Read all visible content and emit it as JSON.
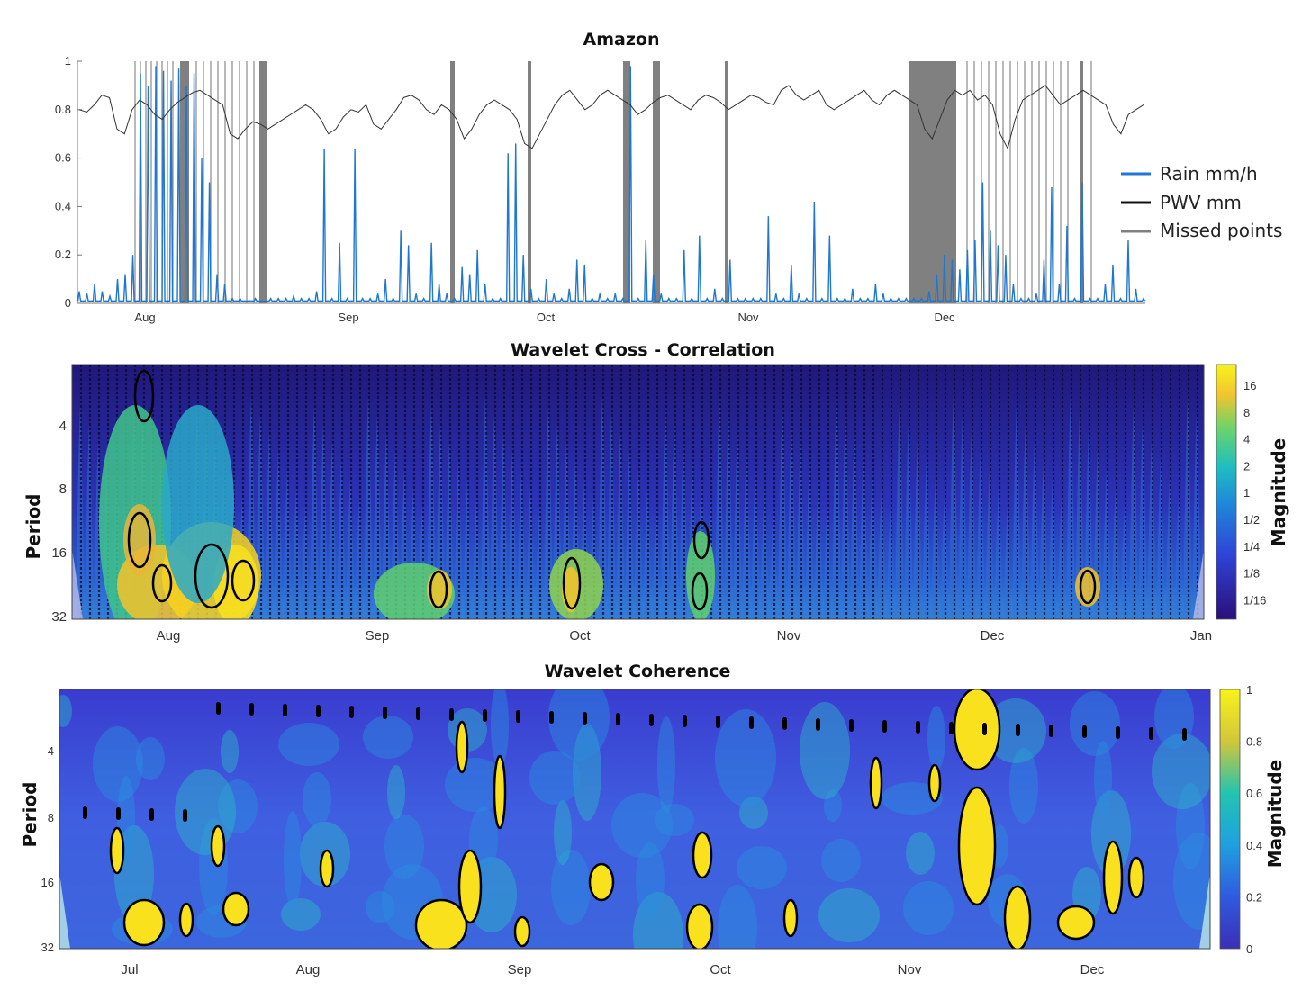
{
  "chart_data": [
    {
      "type": "line",
      "title": "Amazon",
      "xlabel": "",
      "ylabel": "",
      "ylim": [
        0,
        1
      ],
      "yticks": [
        "0",
        "0.2",
        "0.4",
        "0.6",
        "0.8",
        "1"
      ],
      "x_tick_labels": [
        "Aug",
        "Sep",
        "Oct",
        "Nov",
        "Dec"
      ],
      "legend": {
        "placement": "right",
        "entries": [
          {
            "label": "Rain mm/h",
            "color": "#1f77d0"
          },
          {
            "label": "PWV mm",
            "color": "#111111"
          },
          {
            "label": "Missed points",
            "color": "#808080"
          }
        ]
      },
      "series": [
        {
          "name": "PWV mm",
          "color": "#333333",
          "values": [
            0.8,
            0.79,
            0.82,
            0.86,
            0.85,
            0.72,
            0.7,
            0.8,
            0.84,
            0.82,
            0.78,
            0.76,
            0.8,
            0.83,
            0.85,
            0.87,
            0.88,
            0.86,
            0.84,
            0.82,
            0.7,
            0.68,
            0.72,
            0.75,
            0.74,
            0.72,
            0.74,
            0.76,
            0.78,
            0.8,
            0.82,
            0.8,
            0.76,
            0.7,
            0.72,
            0.77,
            0.8,
            0.79,
            0.82,
            0.74,
            0.72,
            0.76,
            0.8,
            0.85,
            0.86,
            0.84,
            0.8,
            0.78,
            0.82,
            0.8,
            0.76,
            0.68,
            0.72,
            0.78,
            0.82,
            0.84,
            0.82,
            0.8,
            0.76,
            0.66,
            0.64,
            0.7,
            0.76,
            0.82,
            0.86,
            0.88,
            0.84,
            0.8,
            0.82,
            0.86,
            0.88,
            0.86,
            0.84,
            0.82,
            0.78,
            0.8,
            0.83,
            0.85,
            0.86,
            0.84,
            0.82,
            0.8,
            0.84,
            0.86,
            0.85,
            0.83,
            0.8,
            0.82,
            0.84,
            0.86,
            0.85,
            0.83,
            0.82,
            0.88,
            0.9,
            0.86,
            0.84,
            0.86,
            0.88,
            0.82,
            0.8,
            0.82,
            0.84,
            0.86,
            0.88,
            0.84,
            0.82,
            0.86,
            0.88,
            0.86,
            0.84,
            0.82,
            0.72,
            0.68,
            0.76,
            0.84,
            0.88,
            0.86,
            0.88,
            0.84,
            0.86,
            0.82,
            0.7,
            0.64,
            0.76,
            0.84,
            0.86,
            0.88,
            0.9,
            0.86,
            0.82,
            0.84,
            0.86,
            0.88,
            0.86,
            0.84,
            0.82,
            0.74,
            0.7,
            0.78,
            0.8,
            0.82
          ]
        },
        {
          "name": "Rain mm/h",
          "color": "#1f77d0",
          "values": [
            0.05,
            0.04,
            0.08,
            0.05,
            0.03,
            0.1,
            0.12,
            0.2,
            0.95,
            0.9,
            0.98,
            0.96,
            0.92,
            0.97,
            0.9,
            0.95,
            0.6,
            0.5,
            0.12,
            0.08,
            0.02,
            0.02,
            0.01,
            0.02,
            0.01,
            0.02,
            0.02,
            0.02,
            0.03,
            0.02,
            0.02,
            0.05,
            0.64,
            0.02,
            0.25,
            0.02,
            0.64,
            0.02,
            0.02,
            0.04,
            0.1,
            0.02,
            0.3,
            0.24,
            0.04,
            0.02,
            0.25,
            0.08,
            0.04,
            0.02,
            0.15,
            0.12,
            0.22,
            0.08,
            0.02,
            0.02,
            0.62,
            0.66,
            0.2,
            0.06,
            0.02,
            0.1,
            0.04,
            0.02,
            0.06,
            0.18,
            0.16,
            0.02,
            0.04,
            0.02,
            0.04,
            0.02,
            0.98,
            0.02,
            0.26,
            0.12,
            0.04,
            0.02,
            0.02,
            0.22,
            0.02,
            0.28,
            0.02,
            0.06,
            0.02,
            0.18,
            0.02,
            0.02,
            0.02,
            0.02,
            0.36,
            0.04,
            0.02,
            0.16,
            0.04,
            0.02,
            0.42,
            0.02,
            0.28,
            0.02,
            0.02,
            0.06,
            0.02,
            0.02,
            0.08,
            0.04,
            0.02,
            0.02,
            0.02,
            0.02,
            0.02,
            0.05,
            0.12,
            0.2,
            0.18,
            0.14,
            0.22,
            0.26,
            0.5,
            0.3,
            0.24,
            0.2,
            0.08,
            0.02,
            0.02,
            0.04,
            0.18,
            0.48,
            0.08,
            0.32,
            0.02,
            0.5,
            0.02,
            0.02,
            0.08,
            0.16,
            0.02,
            0.26,
            0.06,
            0.02
          ]
        },
        {
          "name": "Missed points",
          "color": "#808080",
          "values": [],
          "note_text": ""
        }
      ]
    },
    {
      "type": "heatmap",
      "title": "Wavelet Cross - Correlation",
      "xlabel": "",
      "ylabel": "Period",
      "yticks": [
        "4",
        "8",
        "16",
        "32"
      ],
      "x_tick_labels": [
        "Aug",
        "Sep",
        "Oct",
        "Nov",
        "Dec",
        "Jan"
      ],
      "colorbar": {
        "label": "Magnitude",
        "ticks": [
          "16",
          "8",
          "4",
          "2",
          "1",
          "1/2",
          "1/4",
          "1/8",
          "1/16"
        ]
      },
      "colors": {
        "low": "#2a1c8c",
        "mid": "#1fa2d6",
        "high": "#f9e11e"
      }
    },
    {
      "type": "heatmap",
      "title": "Wavelet Coherence",
      "xlabel": "",
      "ylabel": "Period",
      "yticks": [
        "4",
        "8",
        "16",
        "32"
      ],
      "x_tick_labels": [
        "Jul",
        "Aug",
        "Sep",
        "Oct",
        "Nov",
        "Dec"
      ],
      "colorbar": {
        "label": "Magnitude",
        "ticks": [
          "1",
          "0.8",
          "0.6",
          "0.4",
          "0.2",
          "0"
        ]
      },
      "colors": {
        "low": "#3a2fd0",
        "mid": "#2cb7c8",
        "high": "#f9e11e"
      }
    }
  ]
}
